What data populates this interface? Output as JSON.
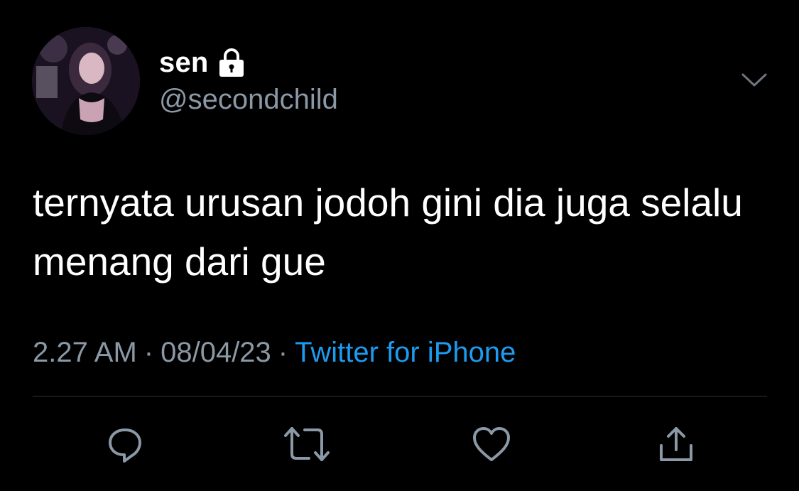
{
  "author": {
    "display_name": "sen",
    "handle": "@secondchild",
    "protected": true
  },
  "tweet": {
    "text": "ternyata urusan jodoh gini dia juga selalu menang dari gue",
    "time": "2.27 AM",
    "date": "08/04/23",
    "separator": "·",
    "source": "Twitter for iPhone"
  },
  "icons": {
    "lock": "lock-icon",
    "more": "chevron-down-icon",
    "reply": "reply-icon",
    "retweet": "retweet-icon",
    "like": "heart-icon",
    "share": "share-icon"
  },
  "colors": {
    "background": "#000000",
    "text": "#ffffff",
    "secondary_text": "#8b98a5",
    "link": "#1d9bf0",
    "divider": "#2f3336"
  }
}
